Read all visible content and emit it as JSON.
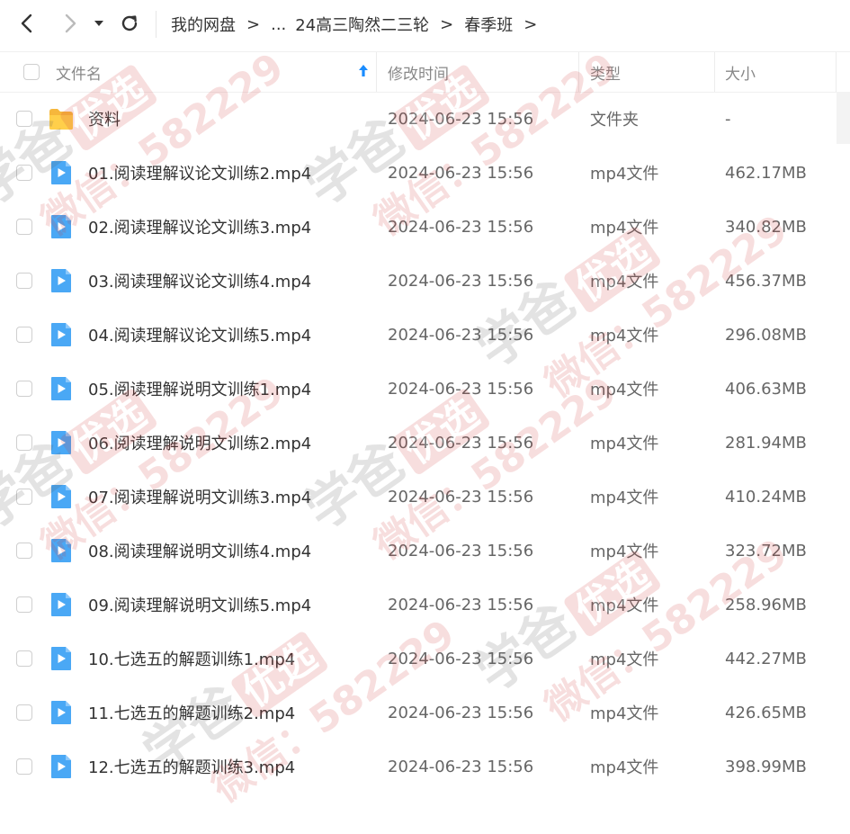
{
  "nav": {
    "back_icon": "chevron-left-icon",
    "forward_icon": "chevron-right-icon",
    "history_icon": "caret-down-icon",
    "refresh_icon": "refresh-icon"
  },
  "breadcrumb": {
    "root": "我的网盘",
    "ellipsis": "...",
    "level1": "24高三陶然二三轮",
    "level2": "春季班",
    "separator": ">"
  },
  "table": {
    "columns": {
      "name": "文件名",
      "modified": "修改时间",
      "type": "类型",
      "size": "大小"
    },
    "sort_icon": "arrow-up-icon",
    "rows": [
      {
        "name": "资料",
        "modified": "2024-06-23 15:56",
        "type": "文件夹",
        "size": "-",
        "icon": "folder-icon"
      },
      {
        "name": "01.阅读理解议论文训练2.mp4",
        "modified": "2024-06-23 15:56",
        "type": "mp4文件",
        "size": "462.17MB",
        "icon": "video-file-icon"
      },
      {
        "name": "02.阅读理解议论文训练3.mp4",
        "modified": "2024-06-23 15:56",
        "type": "mp4文件",
        "size": "340.82MB",
        "icon": "video-file-icon"
      },
      {
        "name": "03.阅读理解议论文训练4.mp4",
        "modified": "2024-06-23 15:56",
        "type": "mp4文件",
        "size": "456.37MB",
        "icon": "video-file-icon"
      },
      {
        "name": "04.阅读理解议论文训练5.mp4",
        "modified": "2024-06-23 15:56",
        "type": "mp4文件",
        "size": "296.08MB",
        "icon": "video-file-icon"
      },
      {
        "name": "05.阅读理解说明文训练1.mp4",
        "modified": "2024-06-23 15:56",
        "type": "mp4文件",
        "size": "406.63MB",
        "icon": "video-file-icon"
      },
      {
        "name": "06.阅读理解说明文训练2.mp4",
        "modified": "2024-06-23 15:56",
        "type": "mp4文件",
        "size": "281.94MB",
        "icon": "video-file-icon"
      },
      {
        "name": "07.阅读理解说明文训练3.mp4",
        "modified": "2024-06-23 15:56",
        "type": "mp4文件",
        "size": "410.24MB",
        "icon": "video-file-icon"
      },
      {
        "name": "08.阅读理解说明文训练4.mp4",
        "modified": "2024-06-23 15:56",
        "type": "mp4文件",
        "size": "323.72MB",
        "icon": "video-file-icon"
      },
      {
        "name": "09.阅读理解说明文训练5.mp4",
        "modified": "2024-06-23 15:56",
        "type": "mp4文件",
        "size": "258.96MB",
        "icon": "video-file-icon"
      },
      {
        "name": "10.七选五的解题训练1.mp4",
        "modified": "2024-06-23 15:56",
        "type": "mp4文件",
        "size": "442.27MB",
        "icon": "video-file-icon"
      },
      {
        "name": "11.七选五的解题训练2.mp4",
        "modified": "2024-06-23 15:56",
        "type": "mp4文件",
        "size": "426.65MB",
        "icon": "video-file-icon"
      },
      {
        "name": "12.七选五的解题训练3.mp4",
        "modified": "2024-06-23 15:56",
        "type": "mp4文件",
        "size": "398.99MB",
        "icon": "video-file-icon"
      }
    ]
  },
  "watermark": {
    "line1": "学爸",
    "badge": "优选",
    "line2": "微信：582229"
  },
  "colors": {
    "accent": "#1a8cff",
    "folder": "#ffc83d",
    "video_icon": "#4aa8f5",
    "watermark": "#d23a3a"
  }
}
